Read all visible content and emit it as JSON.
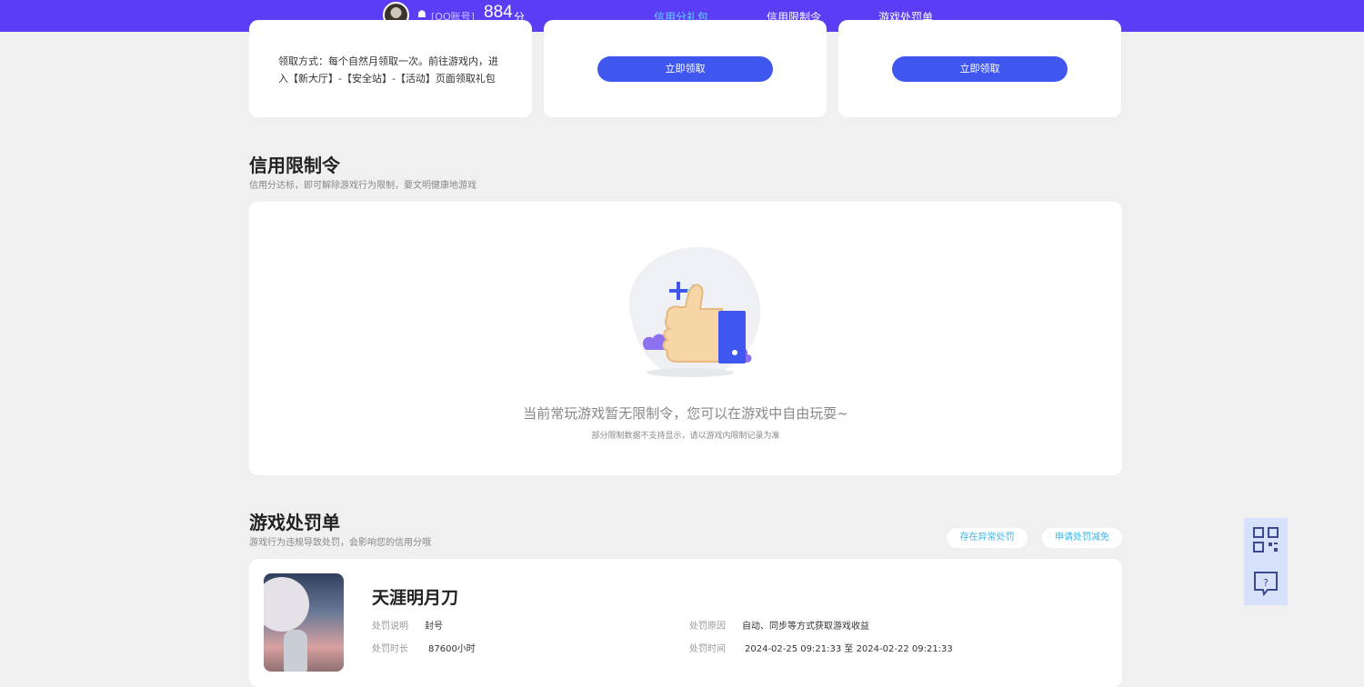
{
  "header": {
    "account_label": "[QQ账号]",
    "score": "884",
    "score_unit": "分",
    "tabs": [
      {
        "label": "信用分礼包",
        "active": true
      },
      {
        "label": "信用限制令",
        "active": false
      },
      {
        "label": "游戏处罚单",
        "active": false
      }
    ]
  },
  "gifts": {
    "claim_method": [
      "领取方式：每个自然月领取一次。前往游戏内，进",
      "入【新大厅】-【安全站】-【活动】页面领取礼包"
    ],
    "button_label": "立即领取"
  },
  "restrictions": {
    "title": "信用限制令",
    "subtitle": "信用分达标，即可解除游戏行为限制，要文明健康地游戏",
    "empty_text": "当前常玩游戏暂无限制令，您可以在游戏中自由玩耍~",
    "empty_note": "部分限制数据不支持显示，请以游戏内限制记录为准"
  },
  "penalties": {
    "title": "游戏处罚单",
    "subtitle": "游戏行为违规导致处罚，会影响您的信用分哦",
    "actions": [
      "存在异常处罚",
      "申请处罚减免"
    ],
    "item": {
      "game_name": "天涯明月刀",
      "desc_label": "处罚说明",
      "desc_value": "封号",
      "duration_label": "处罚时长",
      "duration_value": "87600小时",
      "reason_label": "处罚原因",
      "reason_value": "自动、同步等方式获取游戏收益",
      "time_label": "处罚时间",
      "time_value": "2024-02-25 09:21:33 至 2024-02-22 09:21:33"
    }
  },
  "colors": {
    "topbar": "#5b3df5",
    "button": "#3f57ee",
    "active_tab": "#5fd8ff",
    "pill_text": "#3eb5e6"
  },
  "icons": {
    "qr": "qr-code-icon",
    "feedback": "feedback-icon",
    "empty": "thumbs-up-icon"
  }
}
